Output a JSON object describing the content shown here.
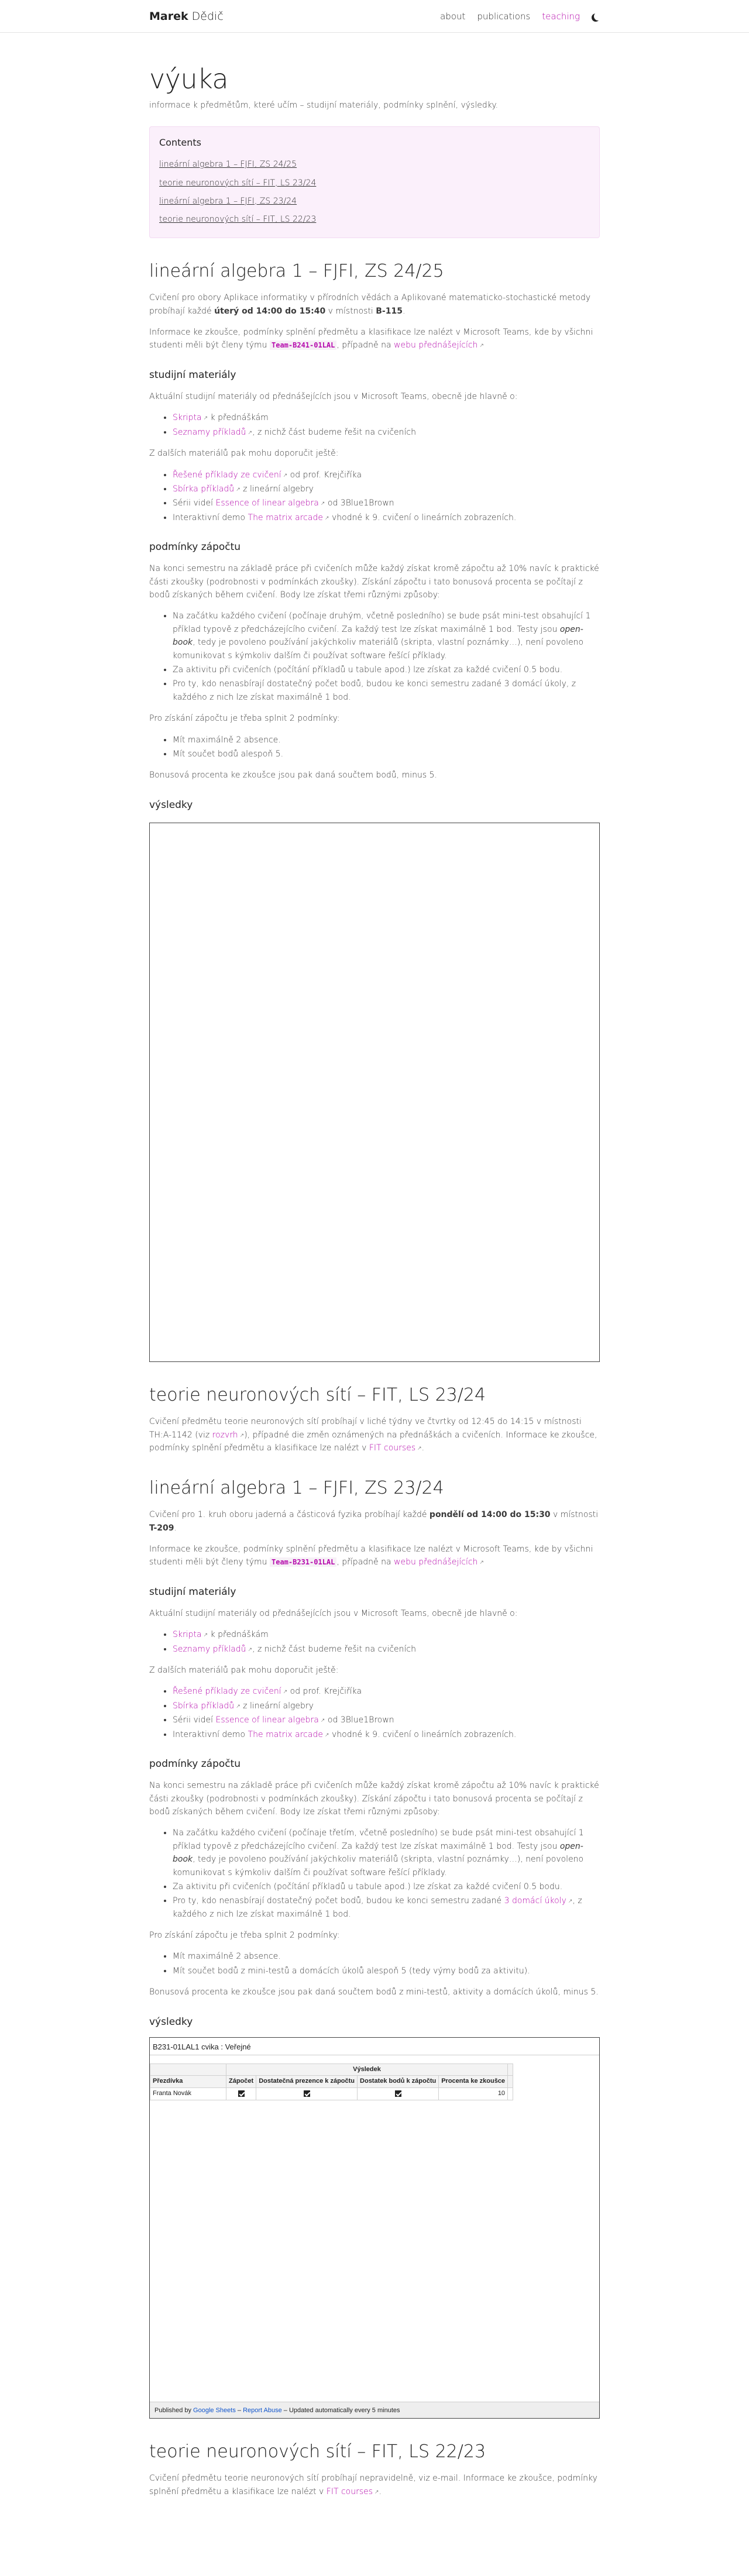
{
  "nav": {
    "brand_first": "Marek",
    "brand_last": "Dědič",
    "links": [
      "about",
      "publications",
      "teaching"
    ]
  },
  "page": {
    "title": "výuka",
    "description": "informace k předmětům, které učím – studijní materiály, podmínky splnění, výsledky."
  },
  "toc": {
    "title": "Contents",
    "items": [
      "lineární algebra 1 – FJFI, ZS 24/25",
      "teorie neuronových sítí – FIT, LS 23/24",
      "lineární algebra 1 – FJFI, ZS 23/24",
      "teorie neuronových sítí – FIT, LS 22/23"
    ]
  },
  "la2425": {
    "title": "lineární algebra 1 – FJFI, ZS 24/25",
    "intro_a": "Cvičení pro obory Aplikace informatiky v přírodních vědách a Aplikované matematicko-stochastické metody probíhají každé ",
    "intro_b": "úterý od 14:00 do 15:40",
    "intro_c": " v místnosti ",
    "intro_d": "B-115",
    "intro_e": ".",
    "teams_a": "Informace ke zkoušce, podmínky splnění předmětu a klasifikace lze nalézt v Microsoft Teams, kde by všichni studenti měli být členy týmu ",
    "teams_code": "Team-B241-01LAL",
    "teams_b": ", případně na ",
    "teams_link": "webu přednášejících",
    "materials_title": "studijní materiály",
    "materials_intro": "Aktuální studijní materiály od přednášejících jsou v Microsoft Teams, obecně jde hlavně o:",
    "m1_link": "Skripta",
    "m1_text": " k přednáškám",
    "m2_link": "Seznamy příkladů",
    "m2_text": ", z nichž část budeme řešit na cvičeních",
    "other_intro": "Z dalších materiálů pak mohu doporučit ještě:",
    "o1_link": "Řešené příklady ze cvičení",
    "o1_text": " od prof. Krejčiříka",
    "o2_link": "Sbírka příkladů",
    "o2_text": " z lineární algebry",
    "o3_pre": "Sérii videí ",
    "o3_link": "Essence of linear algebra",
    "o3_text": " od 3Blue1Brown",
    "o4_pre": "Interaktivní demo ",
    "o4_link": "The matrix arcade",
    "o4_text": " vhodné k 9. cvičení o lineárních zobrazeních.",
    "cond_title": "podmínky zápočtu",
    "cond_p": "Na konci semestru na základě práce při cvičeních může každý získat kromě zápočtu až 10% navíc k praktické části zkoušky (podrobnosti v podmínkách zkoušky). Získání zápočtu i tato bonusová procenta se počítají z bodů získaných během cvičení. Body lze získat třemi různými způsoby:",
    "c1_a": "Na začátku každého cvičení (počínaje druhým, včetně posledního) se bude psát mini-test obsahující 1 příklad typově z předcházejícího cvičení. Za každý test lze získat maximálně 1 bod. Testy jsou ",
    "c1_em": "open-book",
    "c1_b": ", tedy je povoleno používání jakýchkoliv materiálů (skripta, vlastní poznámky…), není povoleno komunikovat s kýmkoliv dalším či používat software řešící příklady.",
    "c2": "Za aktivitu při cvičeních (počítání příkladů u tabule apod.) lze získat za každé cvičení 0.5 bodu.",
    "c3": "Pro ty, kdo nenasbírají dostatečný počet bodů, budou ke konci semestru zadané 3 domácí úkoly, z každého z nich lze získat maximálně 1 bod.",
    "req_intro": "Pro získání zápočtu je třeba splnit 2 podmínky:",
    "r1": "Mít maximálně 2 absence.",
    "r2": "Mít součet bodů alespoň 5.",
    "bonus": "Bonusová procenta ke zkoušce jsou pak daná součtem bodů, minus 5.",
    "results_title": "výsledky"
  },
  "nn2324": {
    "title": "teorie neuronových sítí – FIT, LS 23/24",
    "p_a": "Cvičení předmětu teorie neuronových sítí probíhají v liché týdny ve čtvrtky od 12:45 do 14:15 v místnosti TH:A-1142 (viz ",
    "p_link1": "rozvrh",
    "p_b": "), případné die změn oznámených na přednáškách a cvičeních. Informace ke zkoušce, podmínky splnění předmětu a klasifikace lze nalézt v ",
    "p_link2": "FIT courses",
    "p_c": "."
  },
  "la2324": {
    "title": "lineární algebra 1 – FJFI, ZS 23/24",
    "intro_a": "Cvičení pro 1. kruh oboru jaderná a částicová fyzika probíhají každé ",
    "intro_b": "pondělí od 14:00 do 15:30",
    "intro_c": " v místnosti ",
    "intro_d": "T-209",
    "intro_e": ".",
    "teams_a": "Informace ke zkoušce, podmínky splnění předmětu a klasifikace lze nalézt v Microsoft Teams, kde by všichni studenti měli být členy týmu ",
    "teams_code": "Team-B231-01LAL",
    "teams_b": ", případně na ",
    "teams_link": "webu přednášejících",
    "materials_title": "studijní materiály",
    "materials_intro": "Aktuální studijní materiály od přednášejících jsou v Microsoft Teams, obecně jde hlavně o:",
    "m1_link": "Skripta",
    "m1_text": " k přednáškám",
    "m2_link": "Seznamy příkladů",
    "m2_text": ", z nichž část budeme řešit na cvičeních",
    "other_intro": "Z dalších materiálů pak mohu doporučit ještě:",
    "o1_link": "Řešené příklady ze cvičení",
    "o1_text": " od prof. Krejčiříka",
    "o2_link": "Sbírka příkladů",
    "o2_text": " z lineární algebry",
    "o3_pre": "Sérii videí ",
    "o3_link": "Essence of linear algebra",
    "o3_text": " od 3Blue1Brown",
    "o4_pre": "Interaktivní demo ",
    "o4_link": "The matrix arcade",
    "o4_text": " vhodné k 9. cvičení o lineárních zobrazeních.",
    "cond_title": "podmínky zápočtu",
    "cond_p": "Na konci semestru na základě práce při cvičeních může každý získat kromě zápočtu až 10% navíc k praktické části zkoušky (podrobnosti v podmínkách zkoušky). Získání zápočtu i tato bonusová procenta se počítají z bodů získaných během cvičení. Body lze získat třemi různými způsoby:",
    "c1_a": "Na začátku každého cvičení (počínaje třetím, včetně posledního) se bude psát mini-test obsahující 1 příklad typově z předcházejícího cvičení. Za každý test lze získat maximálně 1 bod. Testy jsou ",
    "c1_em": "open-book",
    "c1_b": ", tedy je povoleno používání jakýchkoliv materiálů (skripta, vlastní poznámky…), není povoleno komunikovat s kýmkoliv dalším či používat software řešící příklady.",
    "c2": "Za aktivitu při cvičeních (počítání příkladů u tabule apod.) lze získat za každé cvičení 0.5 bodu.",
    "c3_a": "Pro ty, kdo nenasbírají dostatečný počet bodů, budou ke konci semestru zadané ",
    "c3_link": "3 domácí úkoly",
    "c3_b": ", z každého z nich lze získat maximálně 1 bod.",
    "req_intro": "Pro získání zápočtu je třeba splnit 2 podmínky:",
    "r1": "Mít maximálně 2 absence.",
    "r2": "Mít součet bodů z mini-testů a domácích úkolů alespoň 5 (tedy výmy bodů za aktivitu).",
    "bonus": "Bonusová procenta ke zkoušce jsou pak daná součtem bodů z mini-testů, aktivity a domácích úkolů, minus 5.",
    "results_title": "výsledky",
    "sheet": {
      "title": "B231-01LAL1 cvika : Veřejné",
      "group_header": "Výsledek",
      "col_name": "Přezdívka",
      "columns": [
        "Zápočet",
        "Dostatečná prezence k zápočtu",
        "Dostatek bodů k zápočtu",
        "Procenta ke zkoušce"
      ],
      "row_name": "Franta Novák",
      "row_percent": "10",
      "footer_a": "Published by ",
      "footer_link1": "Google Sheets",
      "footer_sep": " – ",
      "footer_link2": "Report Abuse",
      "footer_b": " – Updated automatically every 5 minutes"
    }
  },
  "nn2223": {
    "title": "teorie neuronových sítí – FIT, LS 22/23",
    "p_a": "Cvičení předmětu teorie neuronových sítí probíhají nepravidelně, viz e-mail. Informace ke zkoušce, podmínky splnění předmětu a klasifikace lze nalézt v ",
    "p_link": "FIT courses",
    "p_b": "."
  }
}
